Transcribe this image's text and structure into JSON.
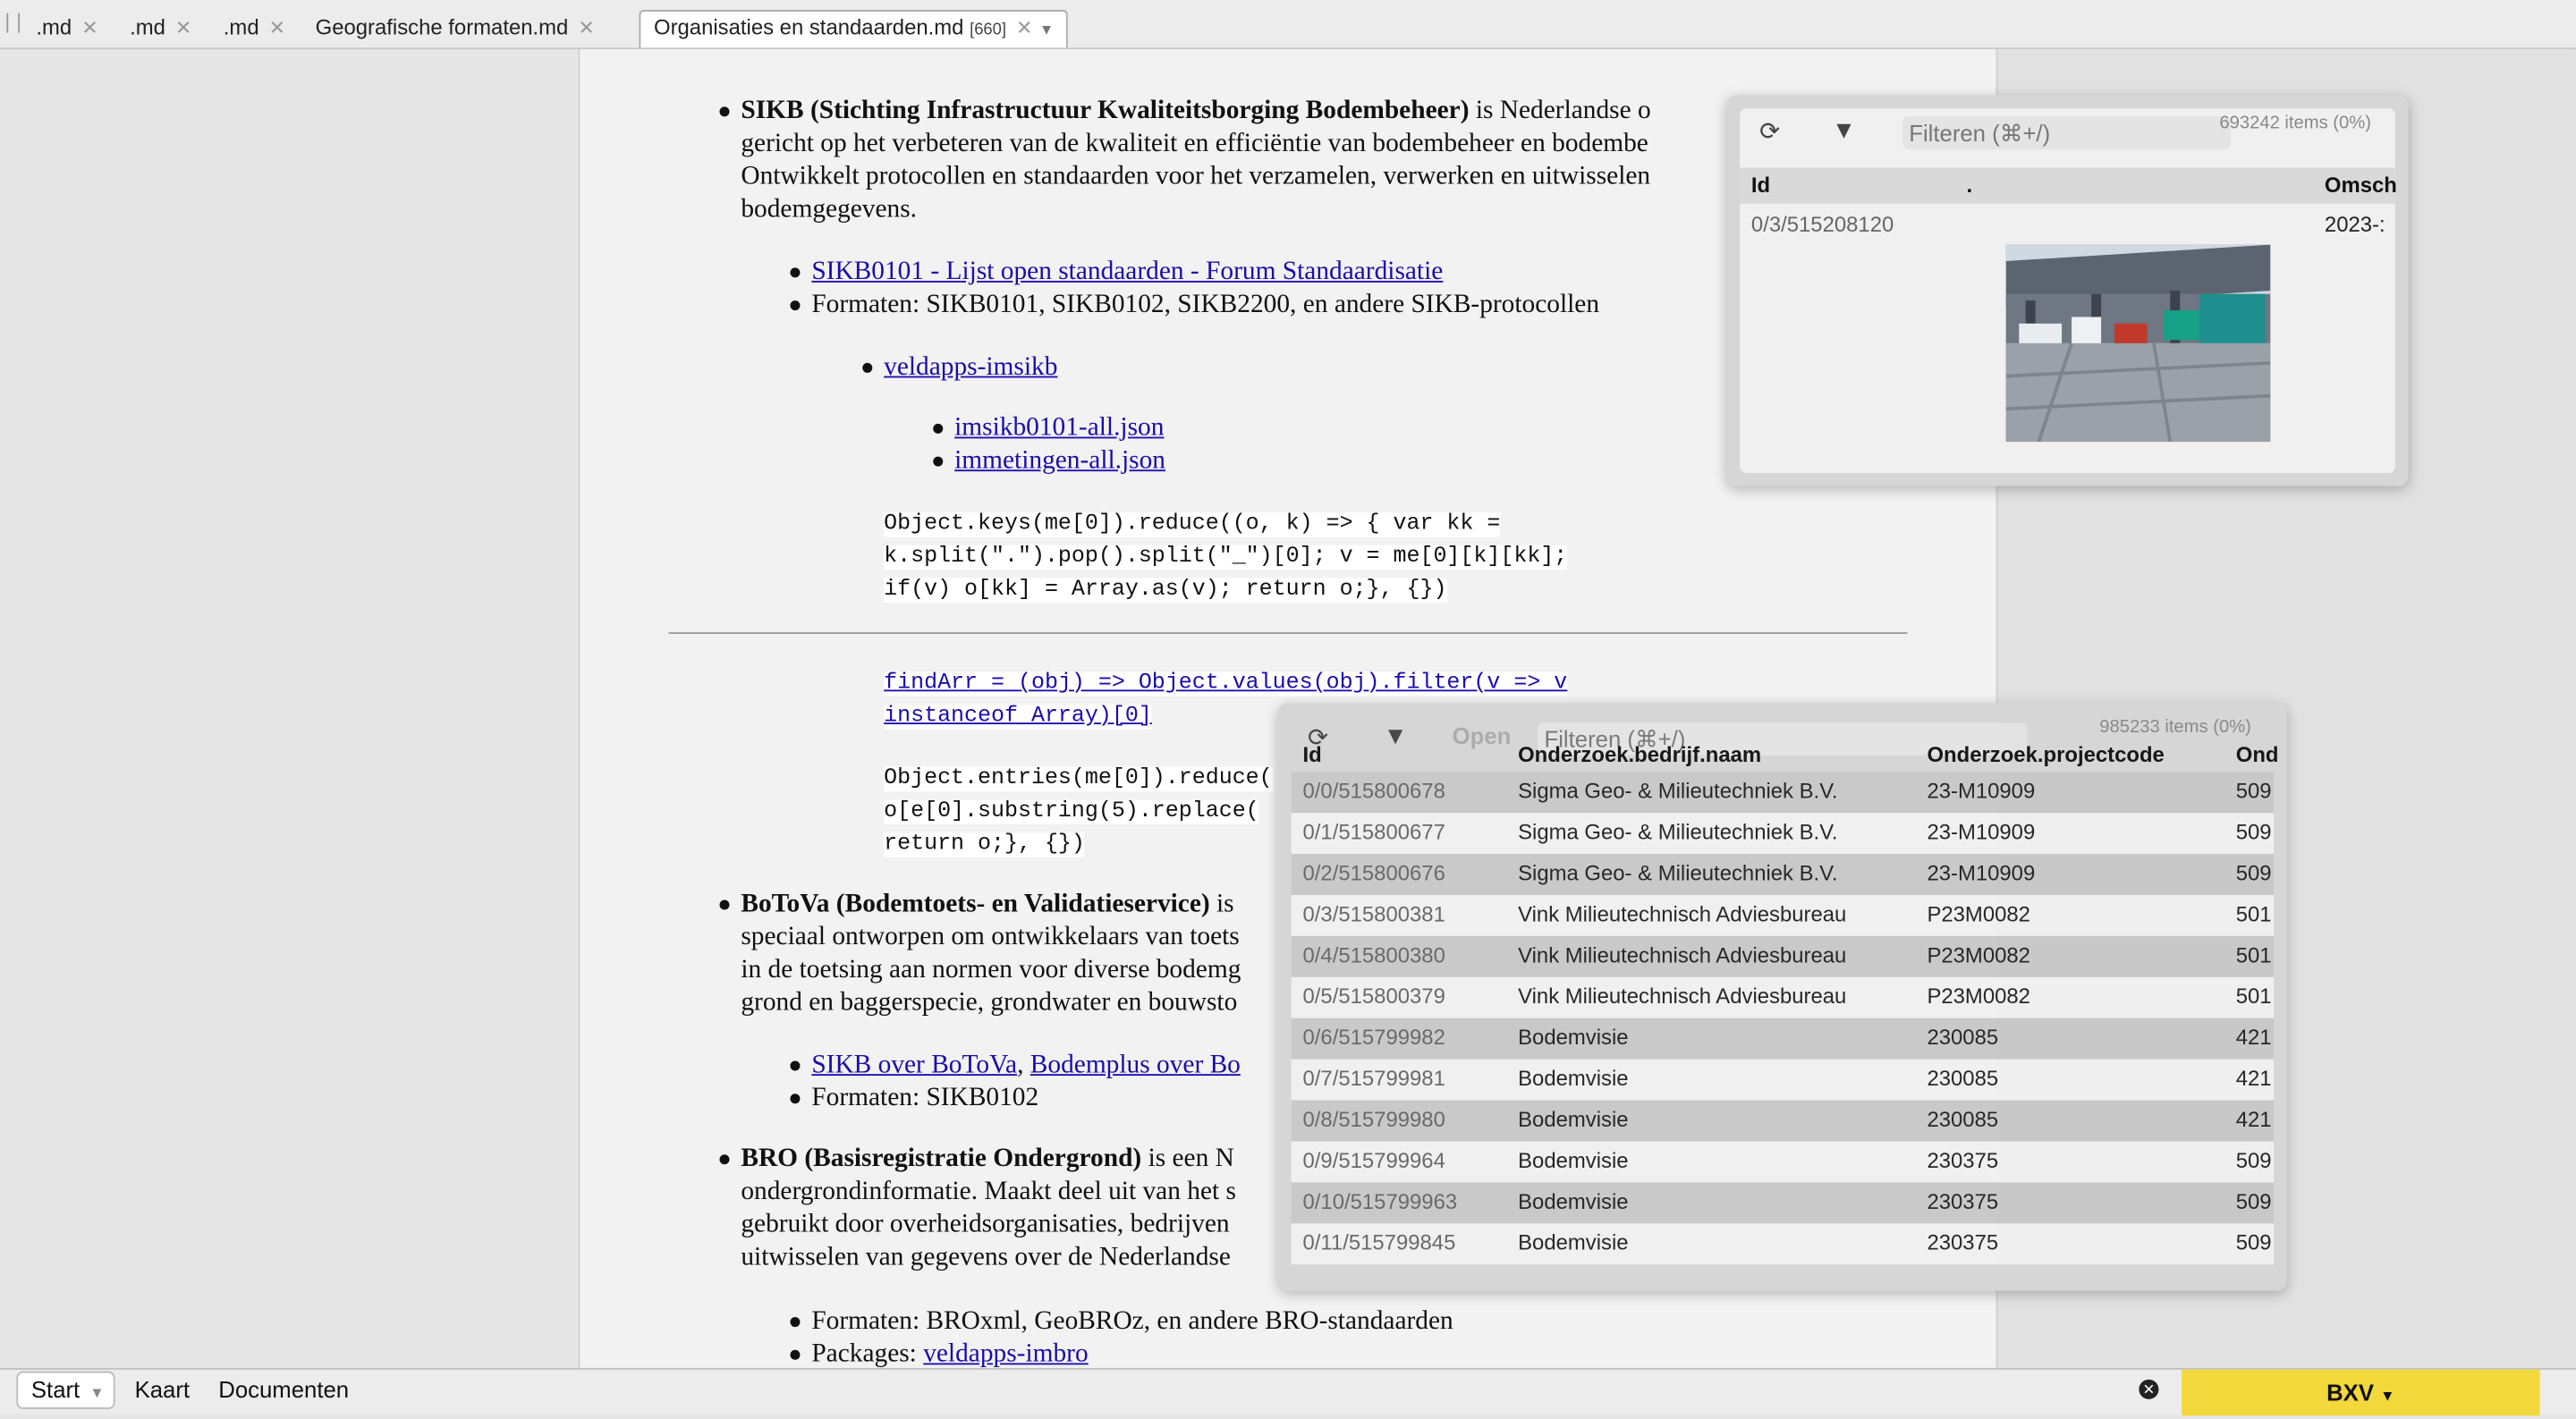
{
  "tabs": [
    {
      "label": ".md"
    },
    {
      "label": ".md"
    },
    {
      "label": ".md"
    },
    {
      "label": "Geografische formaten.md"
    },
    {
      "label": "Organisaties en standaarden.md",
      "count": "[660]"
    }
  ],
  "doc": {
    "sikb": {
      "title": "SIKB (Stichting Infrastructuur Kwaliteitsborging Bodembeheer)",
      "line1_rest": " is Nederlandse o",
      "line2": "gericht op het verbeteren van de kwaliteit en efficiëntie van bodembeheer en bodembe",
      "line3": "Ontwikkelt protocollen en standaarden voor het verzamelen, verwerken en uitwisselen",
      "line4": "bodemgegevens.",
      "link1": "SIKB0101 - Lijst open standaarden - Forum Standaardisatie",
      "formats": "Formaten: SIKB0101, SIKB0102, SIKB2200, en andere SIKB-protocollen",
      "sub_link": "veldapps-imsikb",
      "sub_sub_link1": "imsikb0101-all.json",
      "sub_sub_link2": "immetingen-all.json",
      "code1_l1": "Object.keys(me[0]).reduce((o, k) => { var kk =",
      "code1_l2": "k.split(\".\").pop().split(\"_\")[0]; v = me[0][k][kk];",
      "code1_l3": "if(v) o[kk] = Array.as(v); return o;}, {})",
      "code2_l1": "findArr = (obj) => Object.values(obj).filter(v => v",
      "code2_l2": "instanceof Array)[0]",
      "code3_l1": "Object.entries(me[0]).reduce(",
      "code3_l2": "o[e[0].substring(5).replace(",
      "code3_l3": "return o;}, {})"
    },
    "botova": {
      "title": "BoToVa (Bodemtoets- en Validatieservice)",
      "line1_rest": " is",
      "line2": "speciaal ontworpen om ontwikkelaars van toets",
      "line3": "in de toetsing aan normen voor diverse bodemg",
      "line4": "grond en baggerspecie, grondwater en bouwsto",
      "link1": "SIKB over BoToVa",
      "link_sep": ", ",
      "link2": "Bodemplus over Bo",
      "formats": "Formaten: SIKB0102"
    },
    "bro": {
      "title": "BRO (Basisregistratie Ondergrond)",
      "line1_rest": " is een N",
      "line2": "ondergrondinformatie. Maakt deel uit van het s",
      "line3": "gebruikt door overheidsorganisaties, bedrijven",
      "line4": "uitwisselen van gegevens over de Nederlandse",
      "formats": "Formaten: BROxml, GeoBROz, en andere BRO-standaarden",
      "packages_label": "Packages: ",
      "packages_link": "veldapps-imbro"
    }
  },
  "panel1": {
    "filter_placeholder": "Filteren (⌘+/)",
    "count": "693242 items (0%)",
    "headers": [
      "Id",
      ".",
      "Omsch"
    ],
    "row": {
      "id": "0/3/515208120",
      "date": "2023-:"
    }
  },
  "panel2": {
    "open_label": "Open",
    "filter_placeholder": "Filteren (⌘+/)",
    "count": "985233 items (0%)",
    "headers": [
      "Id",
      "Onderzoek.bedrijf.naam",
      "Onderzoek.projectcode",
      "Ond"
    ],
    "rows": [
      {
        "id": "0/0/515800678",
        "naam": "Sigma Geo- & Milieutechniek B.V.",
        "code": "23-M10909",
        "ond": "509"
      },
      {
        "id": "0/1/515800677",
        "naam": "Sigma Geo- & Milieutechniek B.V.",
        "code": "23-M10909",
        "ond": "509"
      },
      {
        "id": "0/2/515800676",
        "naam": "Sigma Geo- & Milieutechniek B.V.",
        "code": "23-M10909",
        "ond": "509"
      },
      {
        "id": "0/3/515800381",
        "naam": "Vink Milieutechnisch Adviesbureau",
        "code": "P23M0082",
        "ond": "501"
      },
      {
        "id": "0/4/515800380",
        "naam": "Vink Milieutechnisch Adviesbureau",
        "code": "P23M0082",
        "ond": "501"
      },
      {
        "id": "0/5/515800379",
        "naam": "Vink Milieutechnisch Adviesbureau",
        "code": "P23M0082",
        "ond": "501"
      },
      {
        "id": "0/6/515799982",
        "naam": "Bodemvisie",
        "code": "230085",
        "ond": "421"
      },
      {
        "id": "0/7/515799981",
        "naam": "Bodemvisie",
        "code": "230085",
        "ond": "421"
      },
      {
        "id": "0/8/515799980",
        "naam": "Bodemvisie",
        "code": "230085",
        "ond": "421"
      },
      {
        "id": "0/9/515799964",
        "naam": "Bodemvisie",
        "code": "230375",
        "ond": "509"
      },
      {
        "id": "0/10/515799963",
        "naam": "Bodemvisie",
        "code": "230375",
        "ond": "509"
      },
      {
        "id": "0/11/515799845",
        "naam": "Bodemvisie",
        "code": "230375",
        "ond": "509"
      }
    ]
  },
  "bottom": {
    "start_label": "Start",
    "kaart_label": "Kaart",
    "documenten_label": "Documenten",
    "bxv_label": "BXV"
  },
  "colors": {
    "link": "#1a0dab",
    "accent_yellow": "#f2d83a"
  }
}
